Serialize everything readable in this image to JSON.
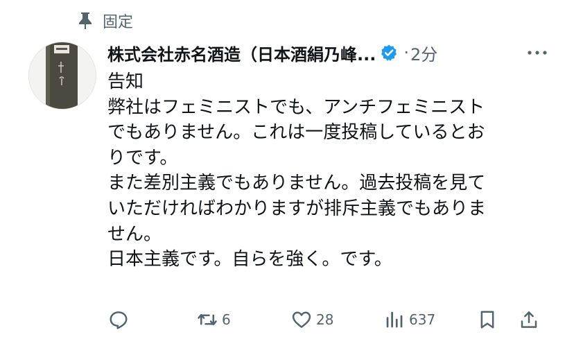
{
  "pinned": {
    "label": "固定",
    "icon": "pin-icon"
  },
  "post": {
    "author_name": "株式会社赤名酒造（日本酒絹乃峰...",
    "verified": true,
    "separator": "·",
    "time": "2分",
    "body_lines": [
      "告知",
      "弊社はフェミニストでも、アンチフェミニスト",
      "でもありません。これは一度投稿しているとお",
      "りです。",
      "また差別主義でもありません。過去投稿を見て",
      "いただければわかりますが排斥主義でもありま",
      "せん。",
      "日本主義です。自らを強く。です。"
    ]
  },
  "actions": {
    "reply": {
      "icon": "reply-icon",
      "count": ""
    },
    "repost": {
      "icon": "repost-icon",
      "count": "6"
    },
    "like": {
      "icon": "heart-icon",
      "count": "28"
    },
    "views": {
      "icon": "views-icon",
      "count": "637"
    },
    "bookmark": {
      "icon": "bookmark-icon",
      "count": ""
    },
    "share": {
      "icon": "share-icon",
      "count": ""
    }
  },
  "colors": {
    "text": "#0f1419",
    "secondary": "#536471",
    "verified_badge": "#1d9bf0"
  }
}
